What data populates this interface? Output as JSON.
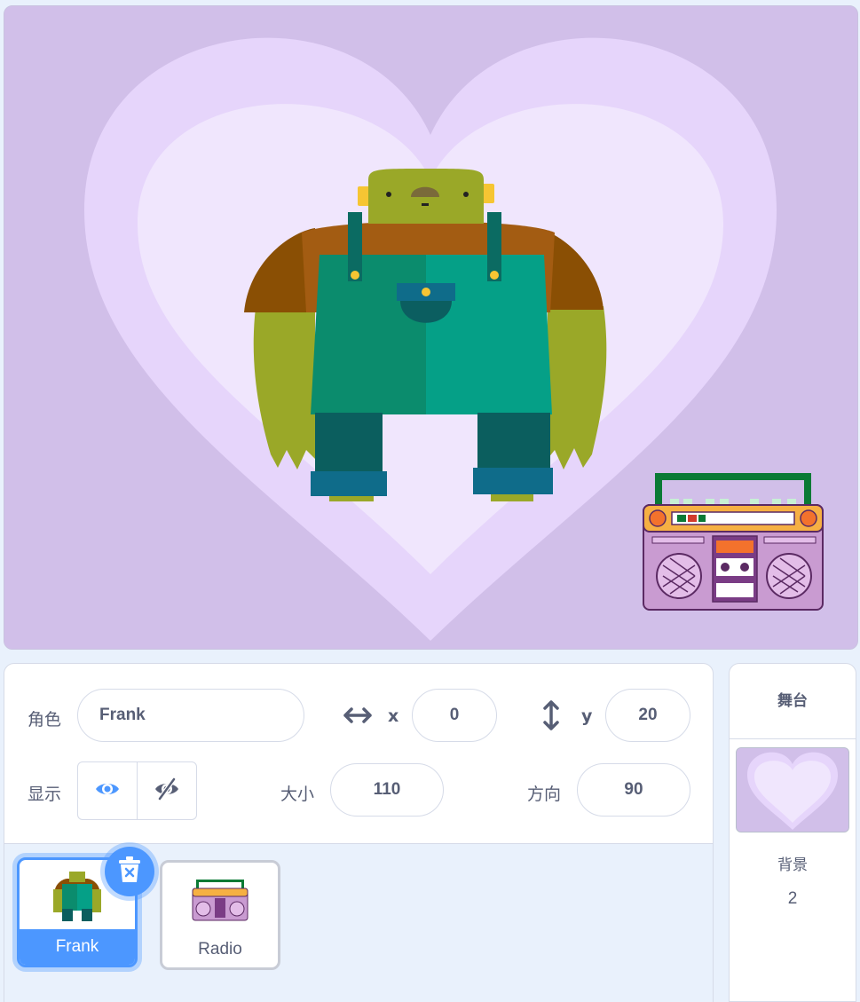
{
  "sprite_info": {
    "sprite_label": "角色",
    "sprite_name": "Frank",
    "x_label": "x",
    "x_value": "0",
    "y_label": "y",
    "y_value": "20",
    "show_label": "显示",
    "size_label": "大小",
    "size_value": "110",
    "direction_label": "方向",
    "direction_value": "90"
  },
  "sprites": [
    {
      "name": "Frank",
      "selected": true
    },
    {
      "name": "Radio",
      "selected": false
    }
  ],
  "stage_panel": {
    "title": "舞台",
    "backdrops_label": "背景",
    "backdrops_count": "2"
  },
  "colors": {
    "accent": "#4c97ff",
    "stage_bg": "#d1bfe9",
    "text": "#575e75"
  },
  "icons": {
    "x_arrows": "horizontal-arrows-icon",
    "y_arrows": "vertical-arrows-icon",
    "show": "eye-icon",
    "hide": "eye-slash-icon",
    "delete": "trash-icon"
  }
}
